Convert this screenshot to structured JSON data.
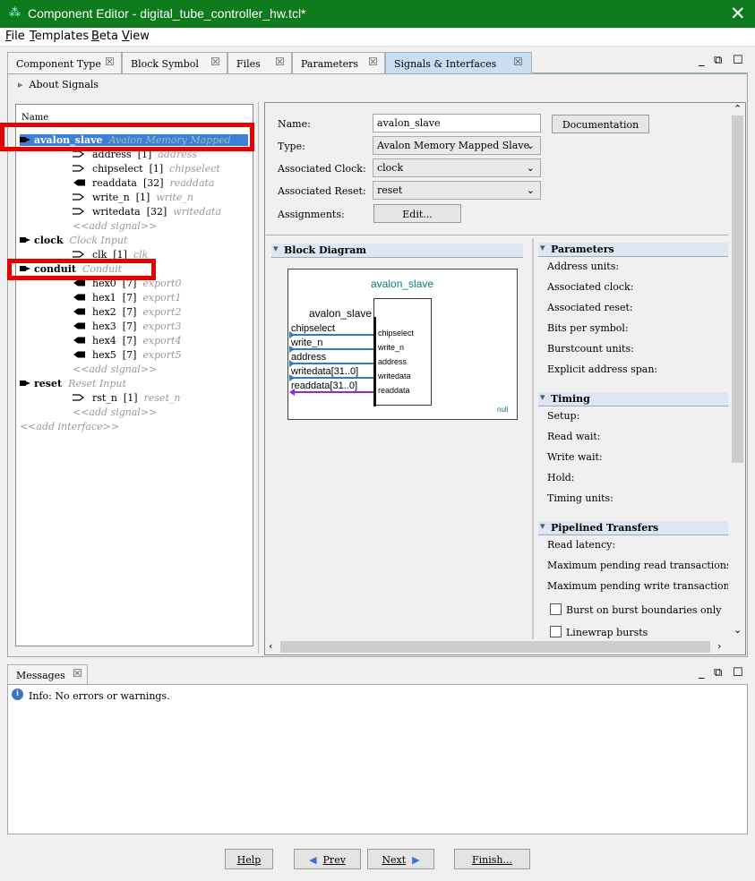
{
  "window": {
    "title": "Component Editor - digital_tube_controller_hw.tcl*",
    "close": "✕"
  },
  "menu": [
    "File",
    "Templates",
    "Beta",
    "View"
  ],
  "tabs": [
    "Component Type",
    "Block Symbol",
    "Files",
    "Parameters",
    "Signals & Interfaces"
  ],
  "about": "About Signals",
  "tree": {
    "header": "Name",
    "interfaces": [
      {
        "name": "avalon_slave",
        "type": "Avalon Memory Mapped",
        "signals": [
          {
            "name": "address",
            "width": "[1]",
            "role": "address",
            "dir": "in"
          },
          {
            "name": "chipselect",
            "width": "[1]",
            "role": "chipselect",
            "dir": "in"
          },
          {
            "name": "readdata",
            "width": "[32]",
            "role": "readdata",
            "dir": "out"
          },
          {
            "name": "write_n",
            "width": "[1]",
            "role": "write_n",
            "dir": "in"
          },
          {
            "name": "writedata",
            "width": "[32]",
            "role": "writedata",
            "dir": "in"
          }
        ]
      },
      {
        "name": "clock",
        "type": "Clock Input",
        "signals": [
          {
            "name": "clk",
            "width": "[1]",
            "role": "clk",
            "dir": "in"
          }
        ]
      },
      {
        "name": "conduit",
        "type": "Conduit",
        "signals": [
          {
            "name": "hex0",
            "width": "[7]",
            "role": "export0",
            "dir": "out"
          },
          {
            "name": "hex1",
            "width": "[7]",
            "role": "export1",
            "dir": "out"
          },
          {
            "name": "hex2",
            "width": "[7]",
            "role": "export2",
            "dir": "out"
          },
          {
            "name": "hex3",
            "width": "[7]",
            "role": "export3",
            "dir": "out"
          },
          {
            "name": "hex4",
            "width": "[7]",
            "role": "export4",
            "dir": "out"
          },
          {
            "name": "hex5",
            "width": "[7]",
            "role": "export5",
            "dir": "out"
          }
        ]
      },
      {
        "name": "reset",
        "type": "Reset Input",
        "signals": [
          {
            "name": "rst_n",
            "width": "[1]",
            "role": "reset_n",
            "dir": "in"
          }
        ]
      }
    ],
    "add_signal": "<<add signal>>",
    "add_interface": "<<add interface>>"
  },
  "form": {
    "name_label": "Name:",
    "name_value": "avalon_slave",
    "type_label": "Type:",
    "type_value": "Avalon Memory Mapped Slave",
    "clock_label": "Associated Clock:",
    "clock_value": "clock",
    "reset_label": "Associated Reset:",
    "reset_value": "reset",
    "assign_label": "Assignments:",
    "edit_button": "Edit...",
    "doc_button": "Documentation"
  },
  "block_diagram": {
    "header": "Block Diagram",
    "title": "avalon_slave",
    "inner_title": "avalon_slave",
    "left_ports": [
      "chipselect",
      "write_n",
      "address",
      "writedata[31..0]",
      "readdata[31..0]"
    ],
    "right_ports": [
      "chipselect",
      "write_n",
      "address",
      "writedata",
      "readdata"
    ],
    "null_label": "null"
  },
  "params": {
    "header": "Parameters",
    "items": [
      "Address units:",
      "Associated clock:",
      "Associated reset:",
      "Bits per symbol:",
      "Burstcount units:",
      "Explicit address span:"
    ],
    "timing_header": "Timing",
    "timing_items": [
      "Setup:",
      "Read wait:",
      "Write wait:",
      "Hold:",
      "Timing units:"
    ],
    "pipelined_header": "Pipelined Transfers",
    "pipelined_items": [
      "Read latency:",
      "Maximum pending read transactions:",
      "Maximum pending write transactions"
    ],
    "checkboxes": [
      "Burst on burst boundaries only",
      "Linewrap bursts"
    ]
  },
  "messages": {
    "tab": "Messages",
    "info": "Info: No errors or warnings."
  },
  "buttons": {
    "help": "Help",
    "prev": "Prev",
    "next": "Next",
    "finish": "Finish..."
  }
}
